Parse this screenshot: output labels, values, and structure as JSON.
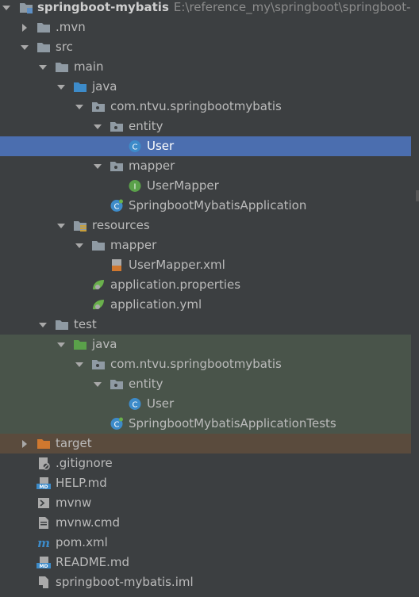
{
  "project": {
    "name": "springboot-mybatis",
    "path": "E:\\reference_my\\springboot\\springboot-m"
  },
  "tree": [
    {
      "id": "root",
      "label": "springboot-mybatis",
      "depth": 0,
      "arrow": "down",
      "icon": "module-folder",
      "bold": true
    },
    {
      "id": "mvn",
      "label": ".mvn",
      "depth": 1,
      "arrow": "right",
      "icon": "folder"
    },
    {
      "id": "src",
      "label": "src",
      "depth": 1,
      "arrow": "down",
      "icon": "folder"
    },
    {
      "id": "main",
      "label": "main",
      "depth": 2,
      "arrow": "down",
      "icon": "folder"
    },
    {
      "id": "java",
      "label": "java",
      "depth": 3,
      "arrow": "down",
      "icon": "source-folder"
    },
    {
      "id": "pkg",
      "label": "com.ntvu.springbootmybatis",
      "depth": 4,
      "arrow": "down",
      "icon": "package"
    },
    {
      "id": "entity",
      "label": "entity",
      "depth": 5,
      "arrow": "down",
      "icon": "package"
    },
    {
      "id": "user",
      "label": "User",
      "depth": 6,
      "arrow": "none",
      "icon": "class",
      "selected": true
    },
    {
      "id": "mapper",
      "label": "mapper",
      "depth": 5,
      "arrow": "down",
      "icon": "package"
    },
    {
      "id": "usermapper",
      "label": "UserMapper",
      "depth": 6,
      "arrow": "none",
      "icon": "interface"
    },
    {
      "id": "app",
      "label": "SpringbootMybatisApplication",
      "depth": 5,
      "arrow": "none",
      "icon": "spring-class"
    },
    {
      "id": "resources",
      "label": "resources",
      "depth": 3,
      "arrow": "down",
      "icon": "resources-folder"
    },
    {
      "id": "resmapper",
      "label": "mapper",
      "depth": 4,
      "arrow": "down",
      "icon": "folder"
    },
    {
      "id": "usermapperxml",
      "label": "UserMapper.xml",
      "depth": 5,
      "arrow": "none",
      "icon": "xml"
    },
    {
      "id": "appprops",
      "label": "application.properties",
      "depth": 4,
      "arrow": "none",
      "icon": "spring-config"
    },
    {
      "id": "appyml",
      "label": "application.yml",
      "depth": 4,
      "arrow": "none",
      "icon": "spring-config"
    },
    {
      "id": "test",
      "label": "test",
      "depth": 2,
      "arrow": "down",
      "icon": "folder"
    },
    {
      "id": "testjava",
      "label": "java",
      "depth": 3,
      "arrow": "down",
      "icon": "test-folder",
      "test": true
    },
    {
      "id": "testpkg",
      "label": "com.ntvu.springbootmybatis",
      "depth": 4,
      "arrow": "down",
      "icon": "package",
      "test": true
    },
    {
      "id": "testentity",
      "label": "entity",
      "depth": 5,
      "arrow": "down",
      "icon": "package",
      "test": true
    },
    {
      "id": "testuser",
      "label": "User",
      "depth": 6,
      "arrow": "none",
      "icon": "class",
      "test": true
    },
    {
      "id": "apptests",
      "label": "SpringbootMybatisApplicationTests",
      "depth": 5,
      "arrow": "none",
      "icon": "spring-class",
      "test": true
    },
    {
      "id": "target",
      "label": "target",
      "depth": 1,
      "arrow": "right",
      "icon": "excluded-folder",
      "excluded": true
    },
    {
      "id": "gitignore",
      "label": ".gitignore",
      "depth": 1,
      "arrow": "none",
      "icon": "ignore-file"
    },
    {
      "id": "help",
      "label": "HELP.md",
      "depth": 1,
      "arrow": "none",
      "icon": "markdown"
    },
    {
      "id": "mvnw",
      "label": "mvnw",
      "depth": 1,
      "arrow": "none",
      "icon": "shell"
    },
    {
      "id": "mvnwcmd",
      "label": "mvnw.cmd",
      "depth": 1,
      "arrow": "none",
      "icon": "text-file"
    },
    {
      "id": "pom",
      "label": "pom.xml",
      "depth": 1,
      "arrow": "none",
      "icon": "maven"
    },
    {
      "id": "readme",
      "label": "README.md",
      "depth": 1,
      "arrow": "none",
      "icon": "markdown"
    },
    {
      "id": "iml",
      "label": "springboot-mybatis.iml",
      "depth": 1,
      "arrow": "none",
      "icon": "iml"
    }
  ],
  "colors": {
    "background": "#3c3f41",
    "selection": "#4b6eaf",
    "test_bg": "#49544a",
    "excluded_bg": "#5a4b3d",
    "text": "#bbbbbb"
  }
}
